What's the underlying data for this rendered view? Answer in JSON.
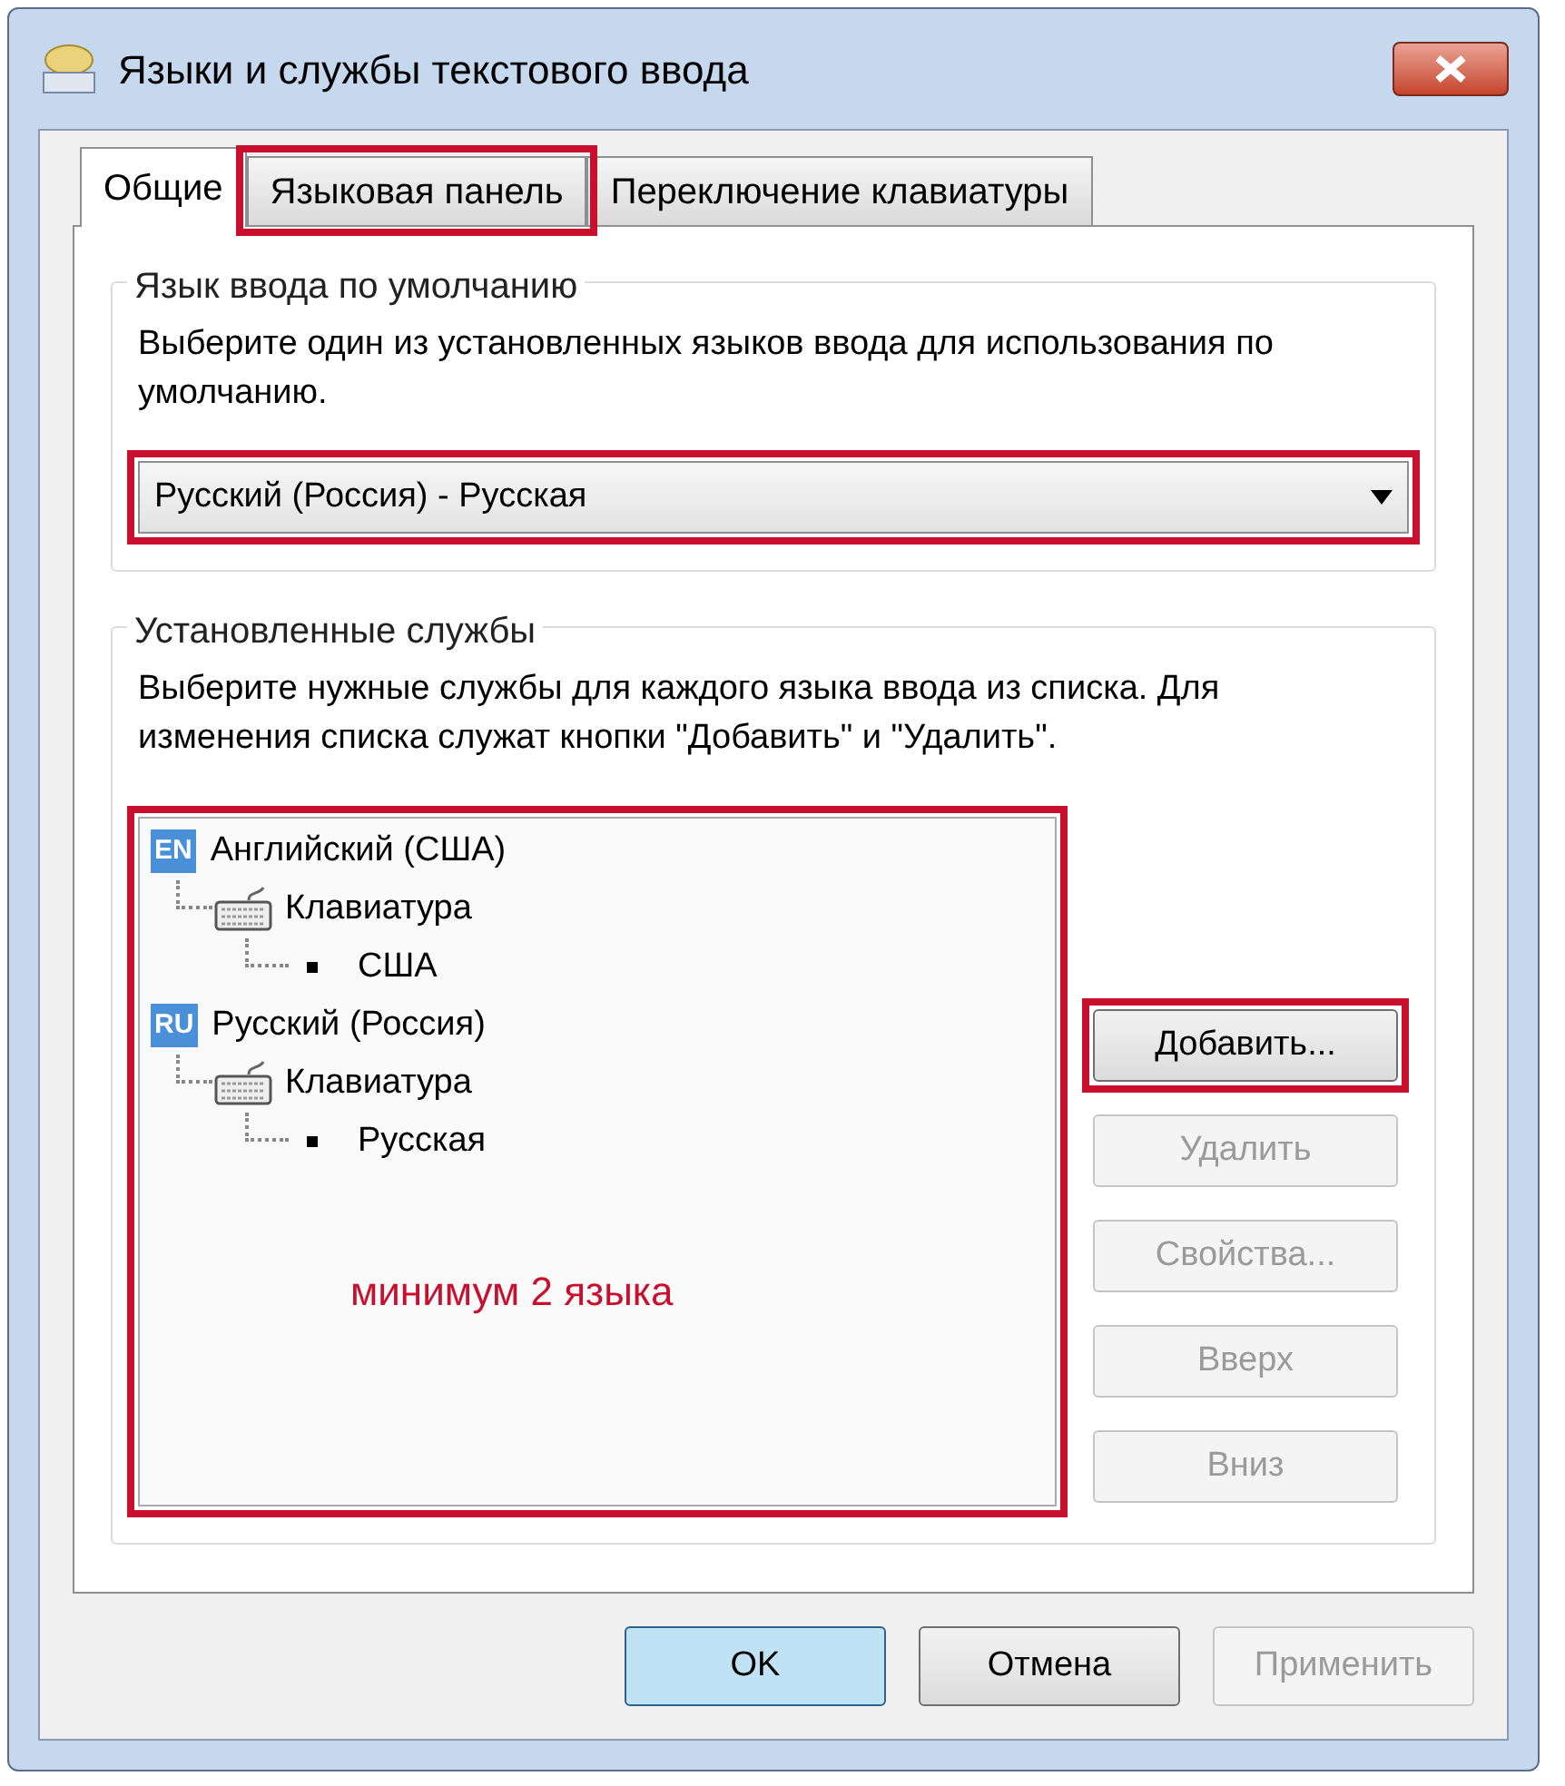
{
  "window": {
    "title": "Языки и службы текстового ввода"
  },
  "tabs": [
    {
      "label": "Общие",
      "selected": true,
      "highlighted": false
    },
    {
      "label": "Языковая панель",
      "selected": false,
      "highlighted": true
    },
    {
      "label": "Переключение клавиатуры",
      "selected": false,
      "highlighted": false
    }
  ],
  "default_language": {
    "heading": "Язык ввода по умолчанию",
    "description": "Выберите один из установленных языков ввода для использования по умолчанию.",
    "dropdown": {
      "value": "Русский (Россия) - Русская",
      "highlighted": true
    }
  },
  "installed_services": {
    "heading": "Установленные службы",
    "description": "Выберите нужные службы для каждого языка ввода из списка. Для изменения списка служат кнопки \"Добавить\" и \"Удалить\".",
    "tree": {
      "highlighted": true,
      "annotation": "минимум 2 языка",
      "items": [
        {
          "badge": "EN",
          "label": "Английский (США)",
          "children": [
            {
              "label": "Клавиатура",
              "children": [
                {
                  "label": "США"
                }
              ]
            }
          ]
        },
        {
          "badge": "RU",
          "label": "Русский (Россия)",
          "children": [
            {
              "label": "Клавиатура",
              "children": [
                {
                  "label": "Русская"
                }
              ]
            }
          ]
        }
      ]
    },
    "buttons": [
      {
        "label": "Добавить...",
        "disabled": false,
        "highlighted": true
      },
      {
        "label": "Удалить",
        "disabled": true,
        "highlighted": false
      },
      {
        "label": "Свойства...",
        "disabled": true,
        "highlighted": false
      },
      {
        "label": "Вверх",
        "disabled": true,
        "highlighted": false
      },
      {
        "label": "Вниз",
        "disabled": true,
        "highlighted": false
      }
    ]
  },
  "footer_buttons": [
    {
      "label": "OK",
      "kind": "default",
      "disabled": false
    },
    {
      "label": "Отмена",
      "kind": "normal",
      "disabled": false
    },
    {
      "label": "Применить",
      "kind": "normal",
      "disabled": true
    }
  ]
}
